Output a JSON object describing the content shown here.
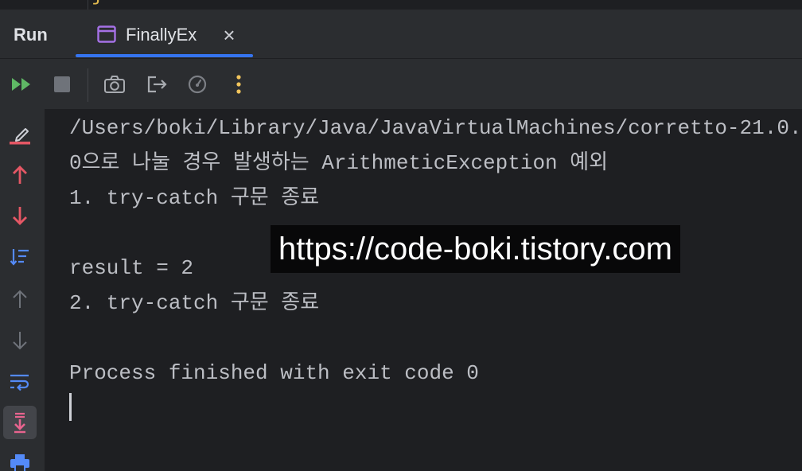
{
  "editor_fragment": {
    "brace": "}"
  },
  "header": {
    "title": "Run",
    "tabs": [
      {
        "label": "FinallyEx",
        "icon": "application-window-icon",
        "active": true,
        "close_glyph": "×"
      }
    ]
  },
  "toolbar": {
    "buttons": [
      {
        "icon": "rerun-icon",
        "enabled": true
      },
      {
        "icon": "stop-icon",
        "enabled": false
      },
      {
        "icon": "camera-icon",
        "enabled": true
      },
      {
        "icon": "exit-icon",
        "enabled": true
      },
      {
        "icon": "gauge-icon",
        "enabled": true
      },
      {
        "icon": "more-vertical-icon",
        "enabled": true
      }
    ]
  },
  "gutter": {
    "buttons": [
      {
        "icon": "clear-all-icon"
      },
      {
        "icon": "up-arrow-icon"
      },
      {
        "icon": "down-arrow-icon"
      },
      {
        "icon": "sort-icon"
      },
      {
        "icon": "up-arrow-icon"
      },
      {
        "icon": "down-arrow-icon"
      },
      {
        "icon": "soft-wrap-icon"
      },
      {
        "icon": "scroll-to-end-icon",
        "selected": true
      },
      {
        "icon": "print-icon"
      }
    ]
  },
  "console": {
    "lines": [
      "/Users/boki/Library/Java/JavaVirtualMachines/corretto-21.0.",
      "0으로 나눌 경우 발생하는 ArithmeticException 예외",
      "1. try-catch 구문 종료",
      "",
      "result = 2",
      "2. try-catch 구문 종료",
      "",
      "Process finished with exit code 0"
    ],
    "cursor_visible": true
  },
  "watermark": {
    "text": "https://code-boki.tistory.com"
  },
  "colors": {
    "panel_background": "#2b2d30",
    "console_background": "#1e1f22",
    "console_text": "#bcbec4",
    "tab_accent": "#3574f0",
    "run_green": "#5fb865",
    "navigate_red": "#e55765",
    "action_blue": "#548af7",
    "more_yellow": "#f2c55c"
  }
}
